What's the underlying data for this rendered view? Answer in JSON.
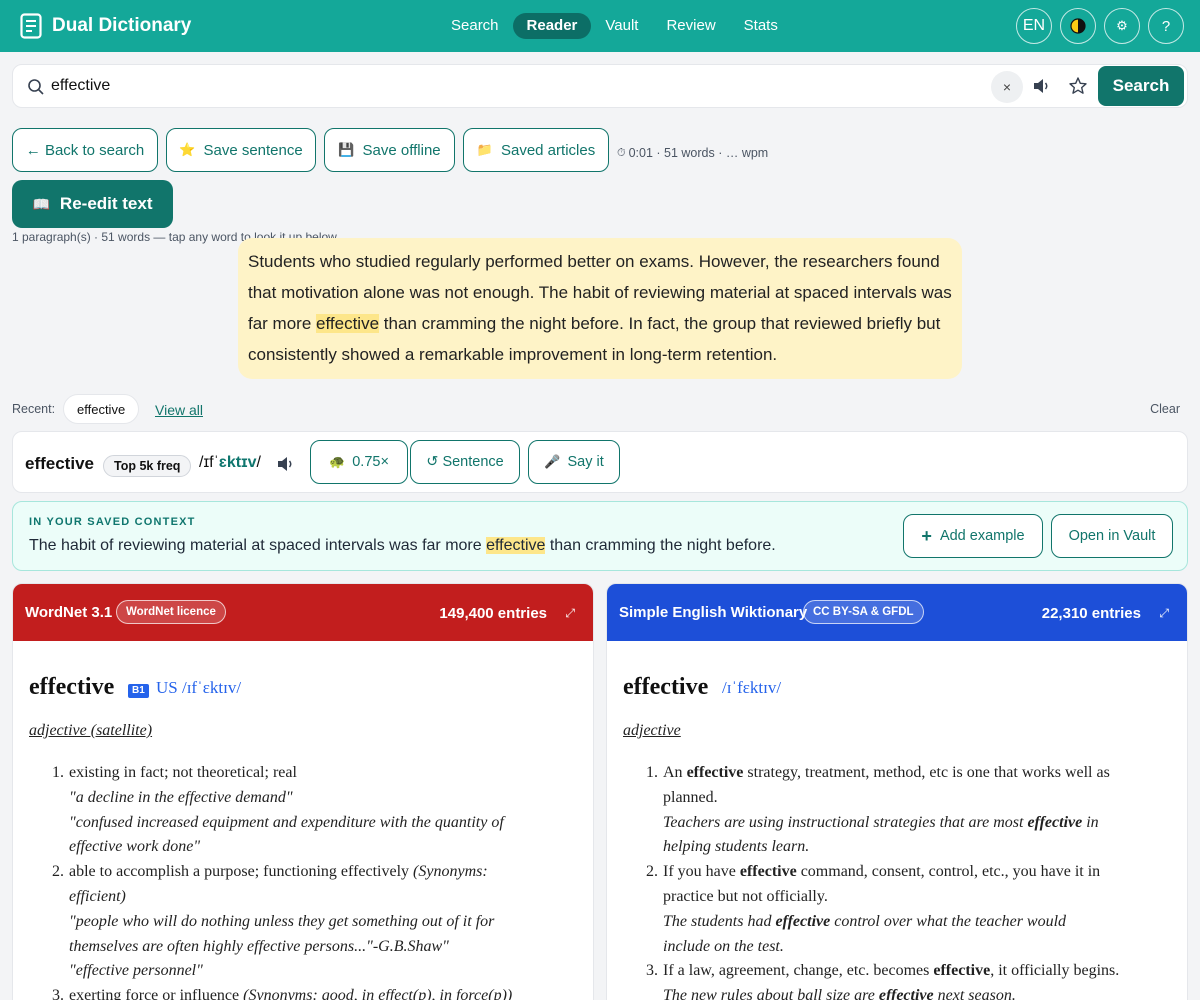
{
  "app": {
    "title": "Dual Dictionary"
  },
  "nav": {
    "items": [
      "Search",
      "Reader",
      "Vault",
      "Review",
      "Stats"
    ],
    "active": "Reader"
  },
  "top_controls": {
    "language": "EN",
    "settings_glyph": "⚙",
    "help": "?"
  },
  "search": {
    "value": "effective",
    "clear": "×",
    "button": "Search"
  },
  "toolbar": {
    "back": "← Back to search",
    "save_sentence": "Save sentence",
    "save_sentence_icon": "⭐",
    "save_offline": "Save offline",
    "save_offline_icon": "💾",
    "saved_articles": "Saved articles",
    "saved_articles_icon": "📁",
    "timer_icon": "⏱",
    "timer": "0:01 · 51 words · … wpm",
    "reedit": "Re-edit text",
    "reedit_icon": "📖"
  },
  "reader": {
    "meta": "1 paragraph(s) · 51 words — tap any word to look it up below.",
    "passage": {
      "lines": [
        {
          "pre": "Students who studied regularly performed better on exams. However, the researchers found",
          "hl": "",
          "post": ""
        },
        {
          "pre": "that motivation alone was not enough. The habit of reviewing material at spaced intervals was",
          "hl": "",
          "post": ""
        },
        {
          "pre": "far more ",
          "hl": "effective",
          "post": " than cramming the night before. In fact, the group that reviewed briefly but"
        },
        {
          "pre": "consistently showed a remarkable improvement in long-term retention.",
          "hl": "",
          "post": ""
        }
      ]
    }
  },
  "recent": {
    "label": "Recent:",
    "chips": [
      "effective"
    ],
    "view_all": "View all",
    "clear": "Clear"
  },
  "word_card": {
    "word": "effective",
    "freq": "Top 5k freq",
    "ipa_pre": "/ɪfˈ",
    "ipa_bold": "ɛktɪv",
    "ipa_post": "/",
    "speed": "0.75×",
    "speed_icon": "🐢",
    "sentence": "↺ Sentence",
    "say_it": "Say it",
    "say_it_icon": "🎤"
  },
  "context": {
    "label": "IN YOUR SAVED CONTEXT",
    "pre": "The habit of reviewing material at spaced intervals was far more ",
    "hl": "effective",
    "post": " than cramming the night before.",
    "add_example": "Add example",
    "add_icon": "+",
    "open_vault": "Open in Vault"
  },
  "panels": [
    {
      "name": "WordNet 3.1",
      "licence": "WordNet licence",
      "entries": "149,400 entries",
      "expand": "⤢",
      "headword": "effective",
      "level": "B1",
      "ipa": "US /ɪfˈɛktɪv/",
      "pos": "adjective (satellite)",
      "defs": [
        {
          "num": "1.",
          "text": "existing in fact; not theoretical; real",
          "examples": [
            "\"a decline in the effective demand\"",
            "\"confused increased equipment and expenditure with the quantity of",
            "effective work done\""
          ]
        },
        {
          "num": "2.",
          "text": "able to accomplish a purpose; functioning effectively ",
          "syn": "(Synonyms:",
          "syn2": "efficient)",
          "examples": [
            "\"people who will do nothing unless they get something out of it for",
            "themselves are often highly effective persons...\"-G.B.Shaw\"",
            "\"effective personnel\""
          ]
        },
        {
          "num": "3.",
          "text": "exerting force or influence ",
          "syn": "(Synonyms: good, in effect(p), in force(p))",
          "examples": []
        }
      ]
    },
    {
      "name": "Simple English Wiktionary",
      "licence": "CC BY-SA & GFDL",
      "entries": "22,310 entries",
      "expand": "⤢",
      "headword": "effective",
      "ipa": "/ɪˈfɛktɪv/",
      "pos": "adjective",
      "defs": [
        {
          "num": "1.",
          "lines": [
            [
              "An ",
              "effective",
              " strategy, treatment, method, etc is one that works well as"
            ],
            [
              "planned.",
              "",
              ""
            ]
          ],
          "ex": [
            [
              "Teachers are using instructional strategies that are most ",
              "effective",
              " in"
            ],
            [
              "helping students learn.",
              "",
              ""
            ]
          ]
        },
        {
          "num": "2.",
          "lines": [
            [
              "If you have ",
              "effective",
              " command, consent, control, etc., you have it in"
            ],
            [
              "practice but not officially.",
              "",
              ""
            ]
          ],
          "ex": [
            [
              "The students had ",
              "effective",
              " control over what the teacher would"
            ],
            [
              "include on the test.",
              "",
              ""
            ]
          ]
        },
        {
          "num": "3.",
          "lines": [
            [
              "If a law, agreement, change, etc. becomes ",
              "effective",
              ", it officially begins."
            ]
          ],
          "ex": [
            [
              "The new rules about ball size are ",
              "effective",
              " next season."
            ]
          ]
        }
      ]
    }
  ],
  "colors": {
    "brand": "#14a899",
    "accent": "#11756b",
    "wordnet": "#c21e1e",
    "wiktionary": "#1d4fd8",
    "highlight": "#fde68a"
  }
}
